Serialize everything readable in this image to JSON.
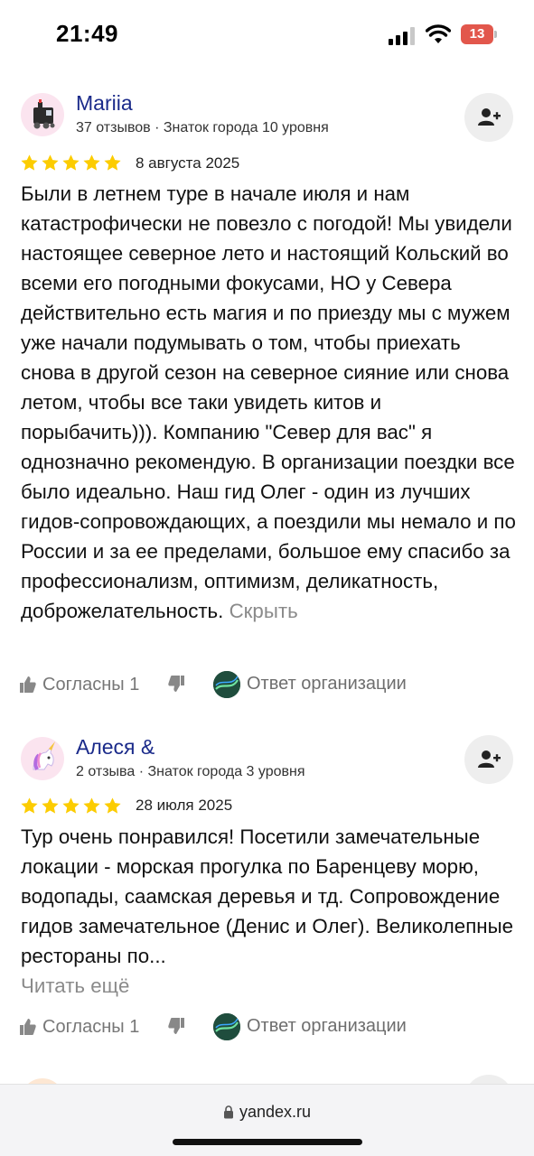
{
  "status_bar": {
    "time": "21:49",
    "battery": "13"
  },
  "reviews": [
    {
      "author": "Mariia",
      "meta": "37 отзывов · Знаток города 10 уровня",
      "rating": 5,
      "date": "8 августа 2025",
      "text": "Были в летнем туре в начале июля и нам катастрофически не повезло с погодой! Мы увидели настоящее северное лето и настоящий Кольский во всеми его погодными фокусами, НО у Севера действительно есть магия и по приезду мы с мужем уже начали подумывать о том, чтобы приехать снова в другой сезон на северное сияние или снова летом, чтобы все таки увидеть китов и порыбачить))). Компанию \"Север для вас\" я однозначно рекомендую. В организации поездки все было идеально. Наш гид Олег - один из лучших гидов-сопровождающих, а поездили мы немало и по России и за ее пределами, большое ему спасибо за профессионализм, оптимизм, деликатность, доброжелательность.",
      "toggle_label": "Скрыть",
      "agree_label": "Согласны 1",
      "org_reply_label": "Ответ организации",
      "avatar_icon": "toy-train-icon"
    },
    {
      "author": "Алеся &",
      "meta": "2 отзыва · Знаток города 3 уровня",
      "rating": 5,
      "date": "28 июля 2025",
      "text": "Тур очень понравился! Посетили замечательные локации - морская прогулка по Баренцеву морю, водопады, саамская деревья и тд. Сопровождение гидов замечательное (Денис и Олег). Великолепные рестораны по...",
      "toggle_label": "Читать ещё",
      "agree_label": "Согласны 1",
      "org_reply_label": "Ответ организации",
      "avatar_icon": "unicorn-icon"
    }
  ],
  "url_bar": {
    "domain": "yandex.ru"
  },
  "colors": {
    "star": "#fccc00",
    "author": "#1a2a8a",
    "muted": "#8a8a8a",
    "battery": "#e2574c"
  }
}
